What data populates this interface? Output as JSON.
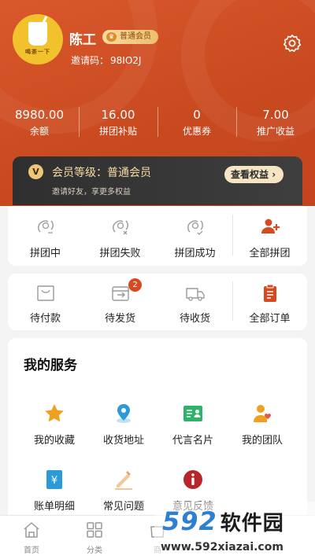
{
  "profile": {
    "name": "陈工",
    "member_level_badge": "普通会员",
    "invite_label": "邀请码：",
    "invite_code": "98IO2J",
    "avatar_brand": "喝茶一下"
  },
  "stats": [
    {
      "value": "8980.00",
      "label": "余额"
    },
    {
      "value": "16.00",
      "label": "拼团补贴"
    },
    {
      "value": "0",
      "label": "优惠券"
    },
    {
      "value": "7.00",
      "label": "推广收益"
    }
  ],
  "vip": {
    "logo": "V",
    "level_text": "会员等级：普通会员",
    "subtitle": "邀请好友，享更多权益",
    "button": "查看权益"
  },
  "group_buy": {
    "items": [
      {
        "label": "拼团中",
        "icon": "group-in-progress-icon"
      },
      {
        "label": "拼团失败",
        "icon": "group-failed-icon"
      },
      {
        "label": "拼团成功",
        "icon": "group-success-icon"
      },
      {
        "label": "全部拼团",
        "icon": "all-groups-icon"
      }
    ]
  },
  "orders": {
    "items": [
      {
        "label": "待付款",
        "icon": "pending-payment-icon"
      },
      {
        "label": "待发货",
        "icon": "pending-shipment-icon",
        "badge": "2"
      },
      {
        "label": "待收货",
        "icon": "pending-receipt-icon"
      },
      {
        "label": "全部订单",
        "icon": "all-orders-icon"
      }
    ]
  },
  "services": {
    "title": "我的服务",
    "items": [
      {
        "label": "我的收藏",
        "icon": "star-icon"
      },
      {
        "label": "收货地址",
        "icon": "location-icon"
      },
      {
        "label": "代言名片",
        "icon": "business-card-icon"
      },
      {
        "label": "我的团队",
        "icon": "team-icon"
      },
      {
        "label": "账单明细",
        "icon": "bill-icon"
      },
      {
        "label": "常见问题",
        "icon": "edit-icon"
      },
      {
        "label": "意见反馈",
        "icon": "feedback-icon"
      }
    ]
  },
  "tabbar": [
    {
      "label": "首页",
      "icon": "home-icon"
    },
    {
      "label": "分类",
      "icon": "category-icon"
    },
    {
      "label": "商",
      "icon": "shop-icon"
    }
  ],
  "watermark": {
    "logo": "592",
    "logo_cn": "软件园",
    "url": "www.592xiazai.com"
  },
  "colors": {
    "accent": "#cf4d23",
    "vip_gold": "#f7dca3",
    "badge_red": "#d64a21"
  }
}
